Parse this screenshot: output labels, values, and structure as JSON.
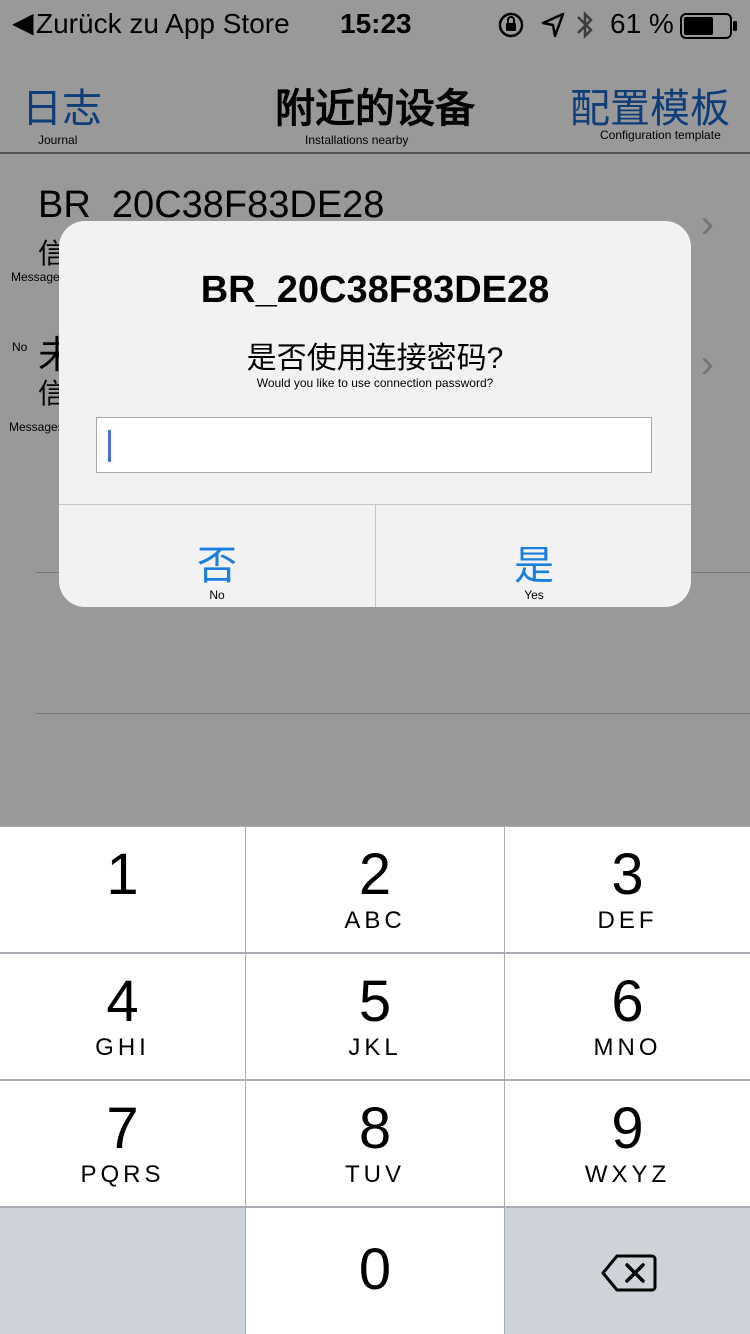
{
  "status_bar": {
    "back_text": "Zurück zu App Store",
    "time": "15:23",
    "battery": "61 %",
    "icons": [
      "back-arrow-icon",
      "lock-rotation-icon",
      "location-icon",
      "bluetooth-icon",
      "battery-icon"
    ]
  },
  "nav": {
    "left_label": "日志",
    "left_sub": "Journal",
    "title": "附近的设备",
    "title_sub": "Installations nearby",
    "right_label": "配置模板",
    "right_sub": "Configuration template"
  },
  "list": {
    "rows": [
      {
        "name": "BR_20C38F83DE28",
        "subtitle": "信",
        "note": "Messages"
      },
      {
        "name": "未",
        "subtitle": "信",
        "note_left": "No",
        "note": "Messages"
      }
    ]
  },
  "alert": {
    "title": "BR_20C38F83DE28",
    "message": "是否使用连接密码?",
    "message_sub": "Would you like to use connection password?",
    "input_value": "",
    "no_label": "否",
    "no_sub": "No",
    "yes_label": "是",
    "yes_sub": "Yes"
  },
  "keypad": {
    "keys": [
      {
        "num": "1",
        "letters": ""
      },
      {
        "num": "2",
        "letters": "ABC"
      },
      {
        "num": "3",
        "letters": "DEF"
      },
      {
        "num": "4",
        "letters": "GHI"
      },
      {
        "num": "5",
        "letters": "JKL"
      },
      {
        "num": "6",
        "letters": "MNO"
      },
      {
        "num": "7",
        "letters": "PQRS"
      },
      {
        "num": "8",
        "letters": "TUV"
      },
      {
        "num": "9",
        "letters": "WXYZ"
      },
      {
        "num": "0",
        "letters": ""
      }
    ],
    "delete_icon": "backspace-icon"
  },
  "colors": {
    "accent": "#1a7fe0",
    "nav_accent": "#1a66c8",
    "overlay": "rgba(0,0,0,0.40)"
  }
}
